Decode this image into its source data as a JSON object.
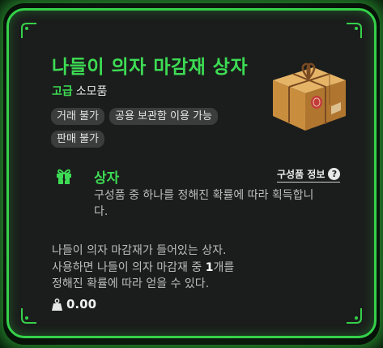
{
  "item": {
    "name": "나들이 의자 마감재 상자",
    "grade": "고급",
    "category": "소모품",
    "tags": [
      "거래 불가",
      "공용 보관함 이용 가능",
      "판매 불가"
    ],
    "box_type": "상자",
    "components_link": "구성품 정보",
    "box_description": "구성품 중 하나를 정해진 확률에 따라 획득합니다.",
    "description_line1": "나들이 의자 마감재가 들어있는 상자.",
    "description_line2_pre": "사용하면 나들이 의자 마감재 중 ",
    "description_line2_bold": "1",
    "description_line2_post": "개를",
    "description_line3": "정해진 확률에 따라 얻을 수 있다.",
    "weight": "0.00"
  },
  "colors": {
    "accent": "#3ddc54",
    "panel_bg": "#1b1d1c",
    "border": "#35d14a",
    "tag_bg": "#3a3d3c"
  },
  "icons": [
    "gift-box-item-icon",
    "gift-icon",
    "question-icon",
    "weight-icon",
    "corner-ornament-icon"
  ]
}
